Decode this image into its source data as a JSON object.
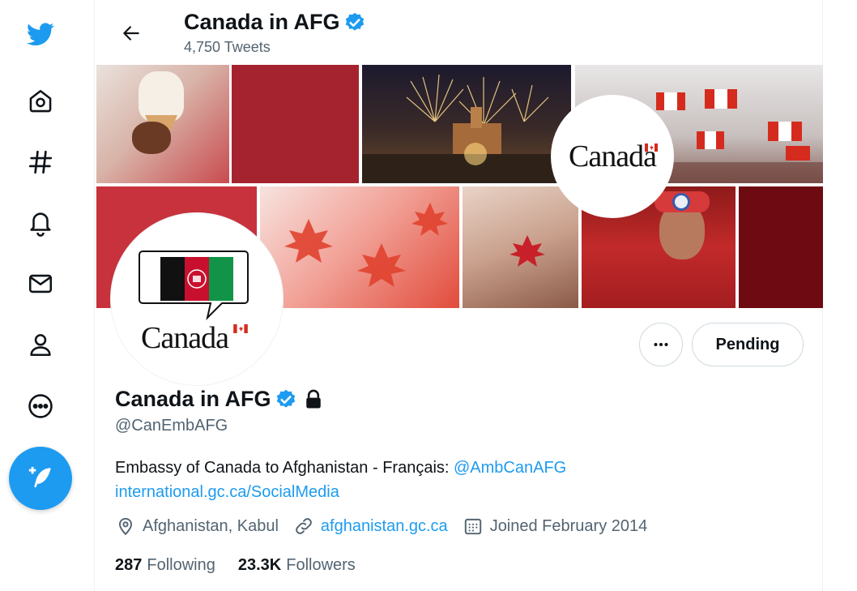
{
  "header": {
    "title": "Canada in AFG",
    "tweet_count": "4,750 Tweets"
  },
  "nav": {
    "items": [
      {
        "icon": "twitter-logo-icon"
      },
      {
        "icon": "home-icon"
      },
      {
        "icon": "explore-hashtag-icon"
      },
      {
        "icon": "notifications-bell-icon"
      },
      {
        "icon": "messages-envelope-icon"
      },
      {
        "icon": "profile-person-icon"
      },
      {
        "icon": "more-circle-icon"
      },
      {
        "icon": "compose-tweet-icon"
      }
    ]
  },
  "banner": {
    "wordmark": "Canada"
  },
  "avatar": {
    "wordmark": "Canada"
  },
  "actions": {
    "more_label": "•••",
    "pending_label": "Pending"
  },
  "profile": {
    "name": "Canada in AFG",
    "handle": "@CanEmbAFG",
    "bio_text": "Embassy of Canada to Afghanistan - Français: ",
    "bio_mention": "@AmbCanAFG",
    "bio_link": "international.gc.ca/SocialMedia",
    "location": "Afghanistan, Kabul",
    "website": "afghanistan.gc.ca",
    "joined": "Joined February 2014",
    "following_count": "287",
    "following_label": "Following",
    "followers_count": "23.3K",
    "followers_label": "Followers"
  },
  "colors": {
    "accent": "#1d9bf0",
    "canada_red": "#a5232e",
    "text": "#0f1419",
    "secondary": "#536471"
  }
}
